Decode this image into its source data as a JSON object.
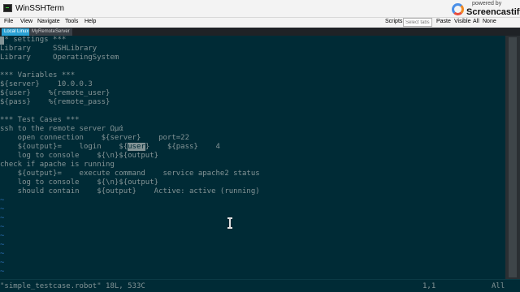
{
  "window": {
    "title": "WinSSHTerm"
  },
  "watermark": {
    "line1": "powered by",
    "line2": "Screencastify"
  },
  "menu": {
    "items": [
      "File",
      "View",
      "Navigate",
      "Tools",
      "Help"
    ],
    "right_items": [
      "Scripts",
      "Paste",
      "Visible",
      "All",
      "None"
    ],
    "search_placeholder": "Select tabs..."
  },
  "tabs": [
    {
      "label": "Local Linux",
      "active": true
    },
    {
      "label": "MyRemoteServer",
      "active": false
    }
  ],
  "editor": {
    "lines": [
      "** settings ***",
      "Library     SSHLibrary",
      "Library     OperatingSystem",
      "",
      "*** Variables ***",
      "${server}    10.0.0.3",
      "${user}    %{remote_user}",
      "${pass}    %{remote_pass}",
      "",
      "*** Test Cases ***",
      "ssh to the remote server Ωμά",
      "    open connection    ${server}    port=22",
      "    ${output}=    login    ${",
      "    log to console    ${\\n}${output}",
      "check if apache is running",
      "    ${output}=    execute command    service apache2 status",
      "    log to console    ${\\n}${output}",
      "    should contain    ${output}    Active: active (running)"
    ],
    "login_highlight": "user",
    "login_tail": "}    ${pass}    4",
    "tilde_char": "~"
  },
  "status": {
    "file": "\"simple_testcase.robot\" 18L, 533C",
    "position": "1,1",
    "scroll": "All"
  },
  "colors": {
    "background": "#002b36",
    "text": "#839496",
    "tilde": "#2c6fb7",
    "active_tab": "#2aa1d3"
  }
}
